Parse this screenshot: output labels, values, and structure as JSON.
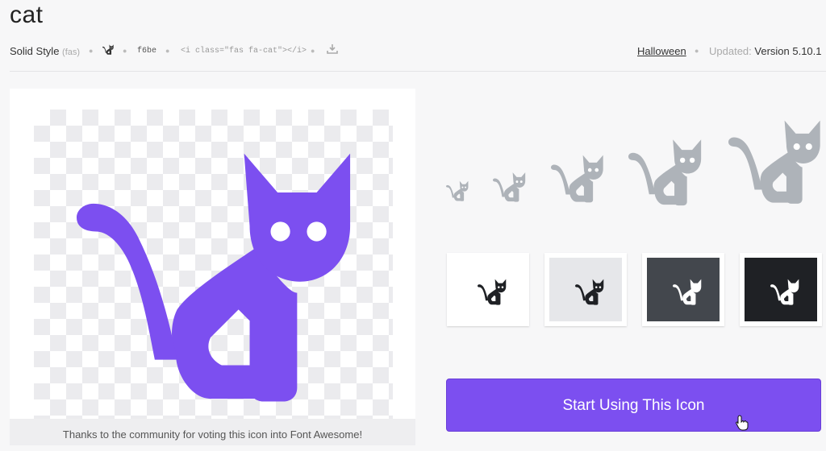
{
  "icon": {
    "name": "cat",
    "unicode": "f6be",
    "html_snippet": "<i class=\"fas fa-cat\"></i>",
    "glyph": "cat-icon"
  },
  "meta": {
    "style_label": "Solid Style",
    "style_code": "(fas)",
    "category_link": "Halloween",
    "updated_label": "Updated:",
    "version": "Version 5.10.1"
  },
  "preview": {
    "color": "#7c4ff0",
    "caption": "Thanks to the community for voting this icon into Font Awesome!"
  },
  "size_variants_color": "#aeb3b9",
  "swatches": [
    {
      "name": "white",
      "bg": "#ffffff",
      "fg": "#1f2125"
    },
    {
      "name": "light-gray",
      "bg": "#e6e7ea",
      "fg": "#1f2125"
    },
    {
      "name": "dark-gray",
      "bg": "#43474d",
      "fg": "#ffffff"
    },
    {
      "name": "black",
      "bg": "#1f2125",
      "fg": "#ffffff"
    }
  ],
  "cta": {
    "label": "Start Using This Icon"
  }
}
